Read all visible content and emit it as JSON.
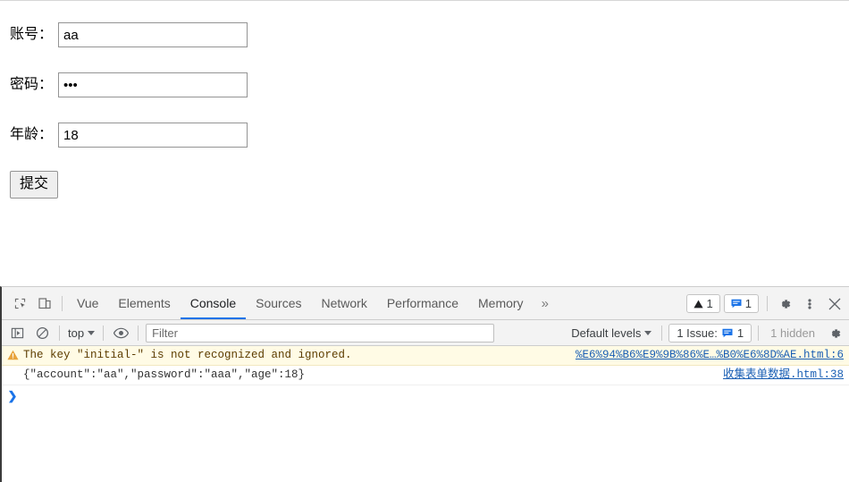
{
  "page": {
    "form": {
      "fields": [
        {
          "label": "账号：",
          "value": "aa",
          "type": "text"
        },
        {
          "label": "密码：",
          "value": "aaa",
          "type": "password"
        },
        {
          "label": "年龄：",
          "value": "18",
          "type": "text"
        }
      ],
      "submit_label": "提交"
    }
  },
  "devtools": {
    "tabs": [
      {
        "label": "Vue",
        "active": false
      },
      {
        "label": "Elements",
        "active": false
      },
      {
        "label": "Console",
        "active": true
      },
      {
        "label": "Sources",
        "active": false
      },
      {
        "label": "Network",
        "active": false
      },
      {
        "label": "Performance",
        "active": false
      },
      {
        "label": "Memory",
        "active": false
      }
    ],
    "more_tabs_label": "»",
    "badges": {
      "warnings_count": "1",
      "messages_count": "1"
    },
    "console_toolbar": {
      "context": "top",
      "filter_placeholder": "Filter",
      "filter_value": "",
      "levels_label": "Default levels",
      "issues_label": "1 Issue:",
      "issues_count": "1",
      "hidden_label": "1 hidden"
    },
    "messages": [
      {
        "level": "warning",
        "text": "The key \"initial-\" is not recognized and ignored.",
        "source": "%E6%94%B6%E9%9B%86%E…%B0%E6%8D%AE.html:6"
      },
      {
        "level": "log",
        "text": "{\"account\":\"aa\",\"password\":\"aaa\",\"age\":18}",
        "source": "收集表单数据.html:38"
      }
    ],
    "prompt_symbol": "❯",
    "prompt_value": ""
  },
  "colors": {
    "accent_blue": "#1a73e8",
    "warning_bg": "#fffbe5",
    "warning_icon": "#e8a33d",
    "link_blue": "#1a5fb4"
  }
}
